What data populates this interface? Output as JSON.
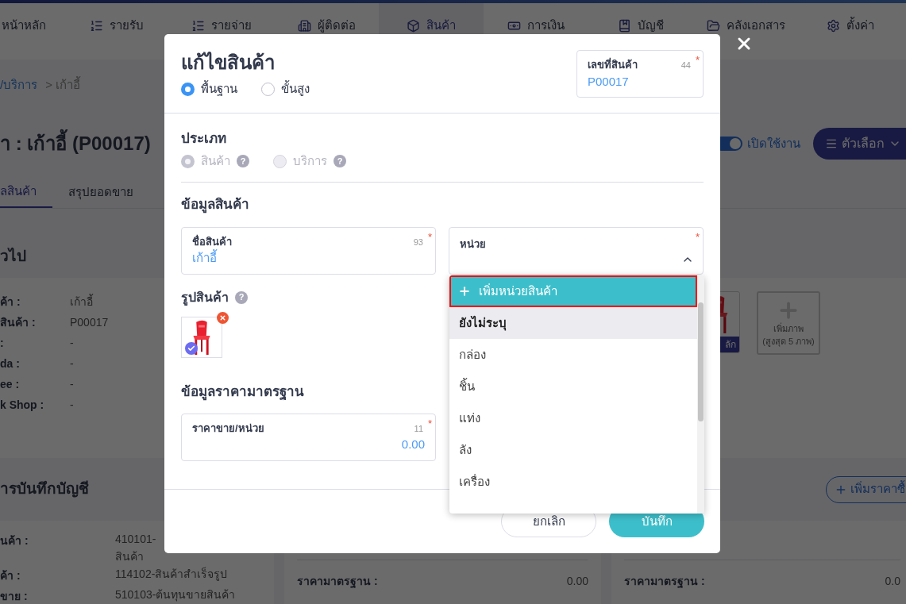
{
  "nav": [
    {
      "label": "หน้าหลัก",
      "selected": false
    },
    {
      "label": "รายรับ",
      "selected": false
    },
    {
      "label": "รายจ่าย",
      "selected": false
    },
    {
      "label": "ผู้ติดต่อ",
      "selected": false
    },
    {
      "label": "สินค้า",
      "selected": true
    },
    {
      "label": "การเงิน",
      "selected": false
    },
    {
      "label": "บัญชี",
      "selected": false
    },
    {
      "label": "คลังเอกสาร",
      "selected": false
    },
    {
      "label": "ตั้งค่า",
      "selected": false
    }
  ],
  "breadcrumb": [
    "/บริการ",
    "> เก้าอี้"
  ],
  "page_title": "า : เก้าอี้ (P00017)",
  "active_toggle": {
    "label": "เปิดใช้งาน",
    "on": true
  },
  "options_button": "ตัวเลือก",
  "tabs": [
    {
      "label": "ลสินค้า",
      "selected": true
    },
    {
      "label": "สรุปยอดขาย",
      "selected": false
    }
  ],
  "general_section": {
    "title": "วไป",
    "rows": [
      {
        "label": "ค้า :",
        "value": "เก้าอี้"
      },
      {
        "label": "สินค้า :",
        "value": "P00017"
      },
      {
        "label": ":",
        "value": "-"
      },
      {
        "label": "da :",
        "value": "-"
      },
      {
        "label": "ee :",
        "value": "-"
      },
      {
        "label": "k Shop :",
        "value": "-"
      }
    ],
    "primary_image_label": "ลัก",
    "add_image_label": "เพิ่มภาพ",
    "add_image_hint": "(สูงสุด 5 ภาพ)"
  },
  "accounting_section": {
    "title": "ารบันทึกบัญชี",
    "add_button": "เพิ่มราคาซื้",
    "rows": [
      {
        "label": "นค้า :",
        "value": "410101-",
        "value_line_2": "สินค้า"
      },
      {
        "label": "ค้า :",
        "value": "114102-สินค้าสำเร็จรูป"
      },
      {
        "label": "ขาย :",
        "value": "510103-ต้นทุนขายสินค้า"
      }
    ],
    "price_cards": [
      {
        "label": "ราคามาตรฐาน :",
        "value": "0.00"
      },
      {
        "label": "ราคามาตรฐาน :",
        "value": "0.0"
      }
    ]
  },
  "modal": {
    "title": "แก้ไขสินค้า",
    "modes": [
      {
        "label": "พื้นฐาน",
        "selected": true
      },
      {
        "label": "ขั้นสูง",
        "selected": false
      }
    ],
    "code_field": {
      "label": "เลขที่สินค้า",
      "counter": "44",
      "required_mark": "*",
      "value": "P00017"
    },
    "type_title": "ประเภท",
    "types": [
      {
        "label": "สินค้า",
        "help": "?",
        "selected": true,
        "disabled": true
      },
      {
        "label": "บริการ",
        "help": "?",
        "selected": false,
        "disabled": true
      }
    ],
    "info_title": "ข้อมูลสินค้า",
    "name_field": {
      "label": "ชื่อสินค้า",
      "counter": "93",
      "required_mark": "*",
      "value": "เก้าอี้"
    },
    "unit_field": {
      "label": "หน่วย",
      "required_mark": "*",
      "expanded": true,
      "options": [
        {
          "kind": "action",
          "label": "เพิ่มหน่วยสินค้า"
        },
        {
          "kind": "option",
          "label": "ยังไม่ระบุ",
          "selected": true
        },
        {
          "kind": "option",
          "label": "กล่อง",
          "selected": false
        },
        {
          "kind": "option",
          "label": "ชิ้น",
          "selected": false
        },
        {
          "kind": "option",
          "label": "แท่ง",
          "selected": false
        },
        {
          "kind": "option",
          "label": "ลัง",
          "selected": false
        },
        {
          "kind": "option",
          "label": "เครื่อง",
          "selected": false
        }
      ]
    },
    "image_title": "รูปสินค้า",
    "image_help": "?",
    "price_title": "ข้อมูลราคามาตรฐาน",
    "price_field": {
      "label": "ราคาขาย/หน่วย",
      "counter": "11",
      "required_mark": "*",
      "value": "0.00"
    },
    "buttons": [
      {
        "kind": "secondary",
        "label": "ยกเลิก"
      },
      {
        "kind": "primary",
        "label": "บันทึก"
      }
    ]
  }
}
